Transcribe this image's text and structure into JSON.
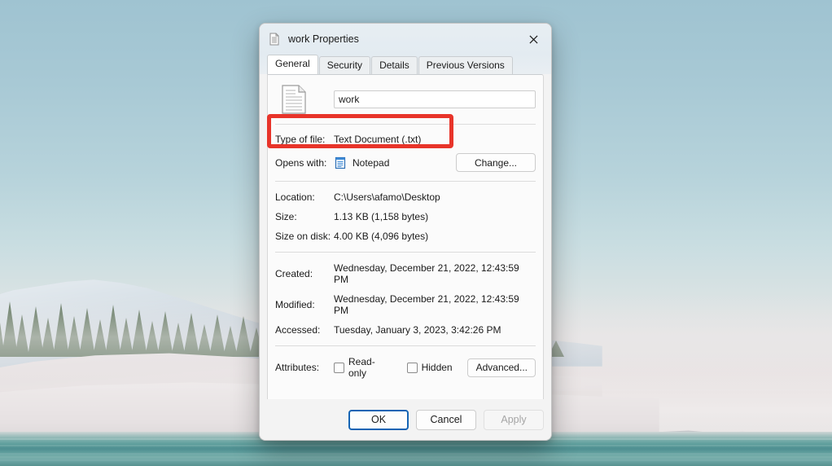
{
  "desktop": {
    "wallpaper_name": "snowy-mountain-lake-wallpaper"
  },
  "dialog": {
    "title": "work Properties",
    "title_icon": "text-document-icon",
    "close_icon": "close-icon",
    "tabs": [
      {
        "label": "General",
        "active": true
      },
      {
        "label": "Security",
        "active": false
      },
      {
        "label": "Details",
        "active": false
      },
      {
        "label": "Previous Versions",
        "active": false
      }
    ],
    "file": {
      "icon": "text-document-large-icon",
      "name_value": "work"
    },
    "fields": {
      "type_of_file_label": "Type of file:",
      "type_of_file_value": "Text Document (.txt)",
      "opens_with_label": "Opens with:",
      "opens_with_value": "Notepad",
      "opens_with_icon": "notepad-icon",
      "change_button": "Change...",
      "location_label": "Location:",
      "location_value": "C:\\Users\\afamo\\Desktop",
      "size_label": "Size:",
      "size_value": "1.13 KB (1,158 bytes)",
      "size_on_disk_label": "Size on disk:",
      "size_on_disk_value": "4.00 KB (4,096 bytes)",
      "created_label": "Created:",
      "created_value": "Wednesday, December 21, 2022, 12:43:59 PM",
      "modified_label": "Modified:",
      "modified_value": "Wednesday, December 21, 2022, 12:43:59 PM",
      "accessed_label": "Accessed:",
      "accessed_value": "Tuesday, January 3, 2023, 3:42:26 PM",
      "attributes_label": "Attributes:",
      "readonly_label": "Read-only",
      "readonly_checked": false,
      "hidden_label": "Hidden",
      "hidden_checked": false,
      "advanced_button": "Advanced..."
    },
    "footer": {
      "ok": "OK",
      "cancel": "Cancel",
      "apply": "Apply",
      "apply_disabled": true
    }
  },
  "annotation": {
    "shape": "rectangle-highlight",
    "color": "#e8342a",
    "targets": "type-of-file-row"
  }
}
